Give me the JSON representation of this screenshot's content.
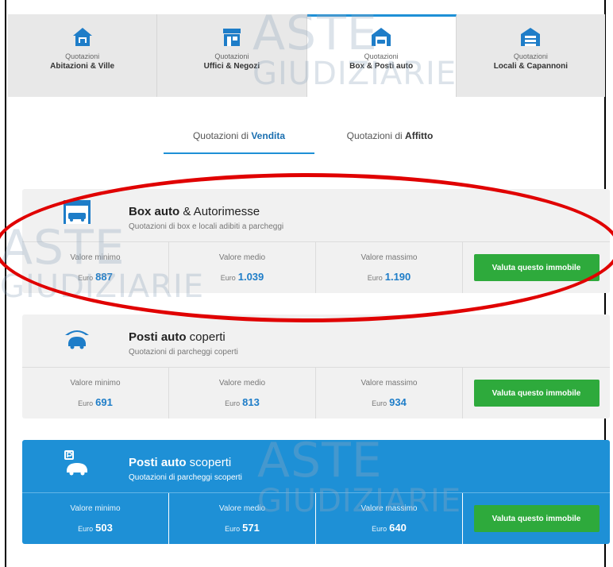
{
  "category_tabs": [
    {
      "small": "Quotazioni",
      "name": "Abitazioni & Ville"
    },
    {
      "small": "Quotazioni",
      "name": "Uffici & Negozi"
    },
    {
      "small": "Quotazioni",
      "name": "Box & Posti auto"
    },
    {
      "small": "Quotazioni",
      "name": "Locali & Capannoni"
    }
  ],
  "active_category": 2,
  "sub_tabs": [
    {
      "prefix": "Quotazioni di ",
      "bold": "Vendita"
    },
    {
      "prefix": "Quotazioni di ",
      "bold": "Affitto"
    }
  ],
  "cards": [
    {
      "title_bold": "Box auto",
      "title_rest": " & Autorimesse",
      "desc": "Quotazioni di box e locali adibiti a parcheggi",
      "stats": [
        {
          "label": "Valore minimo",
          "currency": "Euro",
          "value": "887"
        },
        {
          "label": "Valore medio",
          "currency": "Euro",
          "value": "1.039"
        },
        {
          "label": "Valore massimo",
          "currency": "Euro",
          "value": "1.190"
        }
      ],
      "button": "Valuta questo immobile"
    },
    {
      "title_bold": "Posti auto",
      "title_rest": " coperti",
      "desc": "Quotazioni di parcheggi coperti",
      "stats": [
        {
          "label": "Valore minimo",
          "currency": "Euro",
          "value": "691"
        },
        {
          "label": "Valore medio",
          "currency": "Euro",
          "value": "813"
        },
        {
          "label": "Valore massimo",
          "currency": "Euro",
          "value": "934"
        }
      ],
      "button": "Valuta questo immobile"
    },
    {
      "title_bold": "Posti auto",
      "title_rest": " scoperti",
      "desc": "Quotazioni di parcheggi scoperti",
      "stats": [
        {
          "label": "Valore minimo",
          "currency": "Euro",
          "value": "503"
        },
        {
          "label": "Valore medio",
          "currency": "Euro",
          "value": "571"
        },
        {
          "label": "Valore massimo",
          "currency": "Euro",
          "value": "640"
        }
      ],
      "button": "Valuta questo immobile"
    }
  ],
  "watermark": {
    "line1": "ASTE",
    "line2": "GIUDIZIARIE"
  },
  "colors": {
    "accent": "#1e90d6",
    "button": "#2eaa3c",
    "highlight": "#e00000"
  }
}
